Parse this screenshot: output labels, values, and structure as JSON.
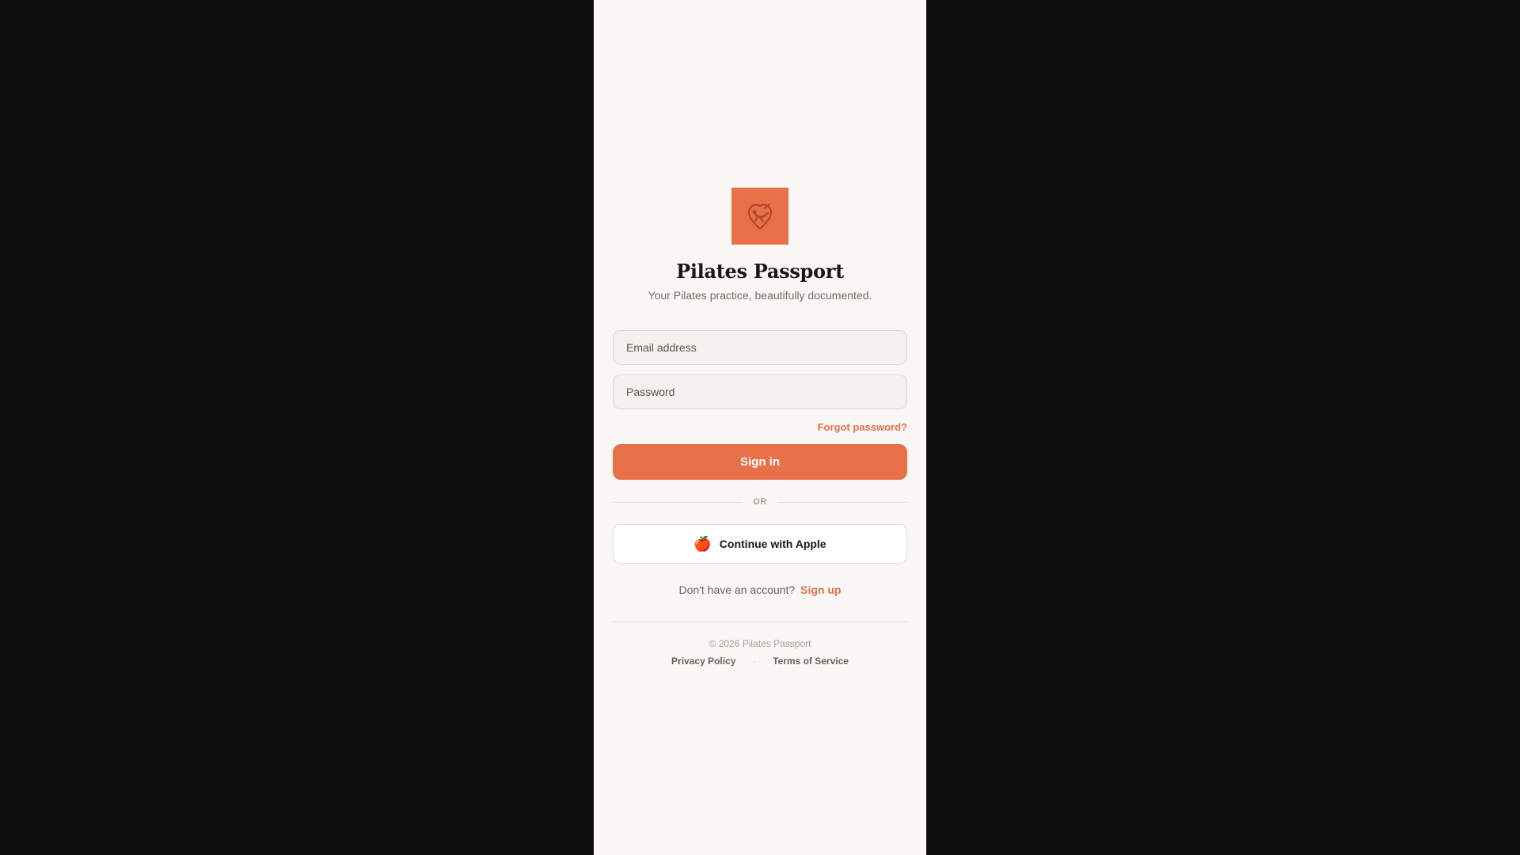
{
  "app": {
    "name": "Pilates Passport",
    "tagline": "Your Pilates practice, beautifully documented.",
    "logo_icon": "pilates-figure-heart-icon"
  },
  "form": {
    "email_placeholder": "Email address",
    "email_value": "",
    "password_placeholder": "Password",
    "password_value": "",
    "forgot_password_label": "Forgot password?",
    "sign_in_label": "Sign in",
    "divider_label": "OR",
    "apple_icon": "apple-icon",
    "apple_label": "Continue with Apple",
    "signup_prompt": "Don't have an account?",
    "signup_link": "Sign up"
  },
  "footer": {
    "copyright": "© 2026 Pilates Passport",
    "privacy_label": "Privacy Policy",
    "separator": "·",
    "terms_label": "Terms of Service"
  },
  "colors": {
    "accent": "#e8714a",
    "page_background": "#0e0e0e",
    "panel_background": "#f9f7f5",
    "heading": "#1c1714"
  }
}
